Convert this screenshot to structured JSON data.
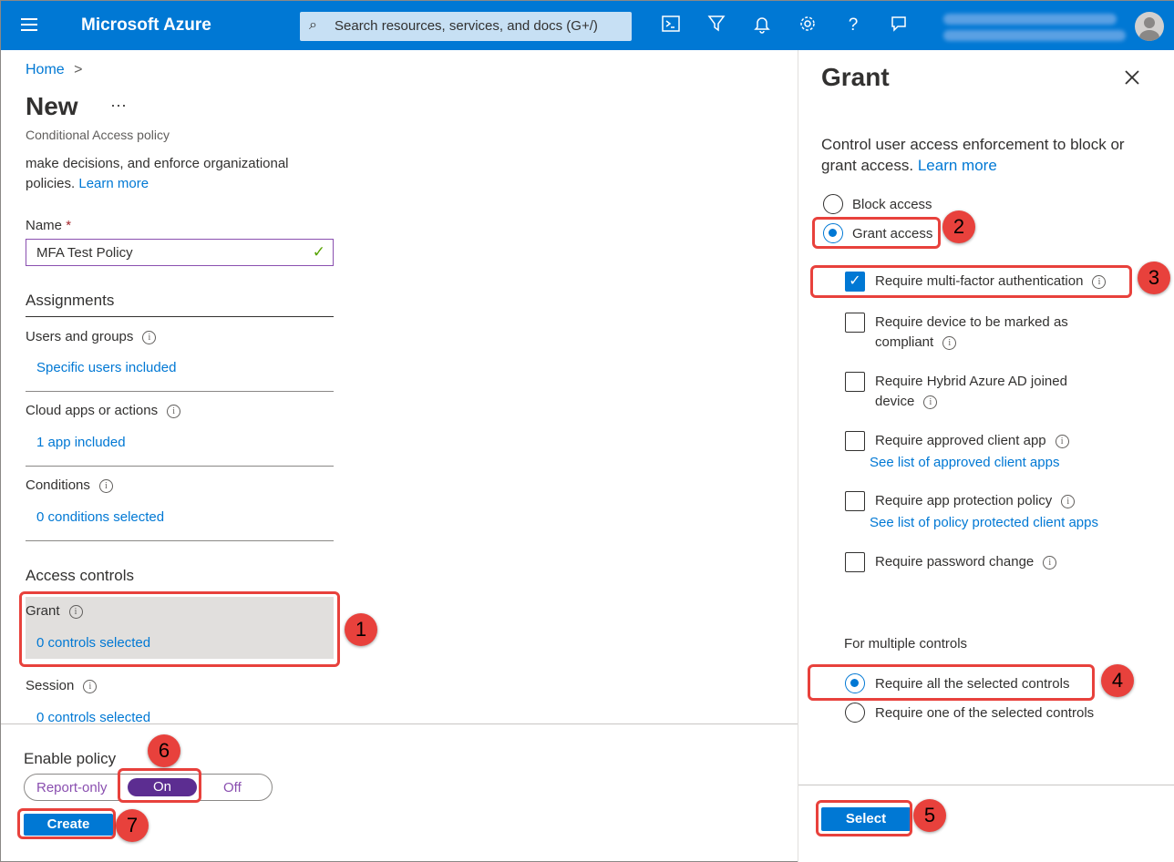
{
  "topbar": {
    "brand": "Microsoft Azure",
    "search_placeholder": "Search resources, services, and docs (G+/)",
    "icons": [
      "cloud-shell-icon",
      "directory-filter-icon",
      "notifications-icon",
      "settings-icon",
      "help-icon",
      "feedback-icon"
    ]
  },
  "breadcrumb": {
    "home": "Home",
    "separator": ">"
  },
  "page": {
    "title": "New",
    "more": "···",
    "subtitle": "Conditional Access policy",
    "description": "make decisions, and enforce organizational policies.",
    "learn_more": "Learn more"
  },
  "name_field": {
    "label": "Name",
    "required_mark": "*",
    "value": "MFA Test Policy"
  },
  "assignments": {
    "heading": "Assignments",
    "users": {
      "label": "Users and groups",
      "value": "Specific users included"
    },
    "cloud_apps": {
      "label": "Cloud apps or actions",
      "value": "1 app included"
    },
    "conditions": {
      "label": "Conditions",
      "value": "0 conditions selected"
    }
  },
  "access_controls": {
    "heading": "Access controls",
    "grant": {
      "label": "Grant",
      "value": "0 controls selected"
    },
    "session": {
      "label": "Session",
      "value": "0 controls selected"
    }
  },
  "enable_policy": {
    "label": "Enable policy",
    "options": [
      "Report-only",
      "On",
      "Off"
    ],
    "selected": "On"
  },
  "create_button": "Create",
  "grant_panel": {
    "title": "Grant",
    "description": "Control user access enforcement to block or grant access.",
    "learn_more": "Learn more",
    "access_options": [
      "Block access",
      "Grant access"
    ],
    "selected_access": "Grant access",
    "controls": [
      {
        "label": "Require multi-factor authentication",
        "checked": true
      },
      {
        "label": "Require device to be marked as compliant",
        "checked": false
      },
      {
        "label": "Require Hybrid Azure AD joined device",
        "checked": false
      },
      {
        "label": "Require approved client app",
        "checked": false,
        "link": "See list of approved client apps"
      },
      {
        "label": "Require app protection policy",
        "checked": false,
        "link": "See list of policy protected client apps"
      },
      {
        "label": "Require password change",
        "checked": false
      }
    ],
    "multiple_heading": "For multiple controls",
    "multiple_options": [
      "Require all the selected controls",
      "Require one of the selected controls"
    ],
    "multiple_selected": "Require all the selected controls",
    "select_button": "Select"
  },
  "annotations": [
    "1",
    "2",
    "3",
    "4",
    "5",
    "6",
    "7"
  ],
  "colors": {
    "azure_blue": "#0078d4",
    "annotation_red": "#e8413c",
    "toggle_purple": "#5c2d91"
  }
}
